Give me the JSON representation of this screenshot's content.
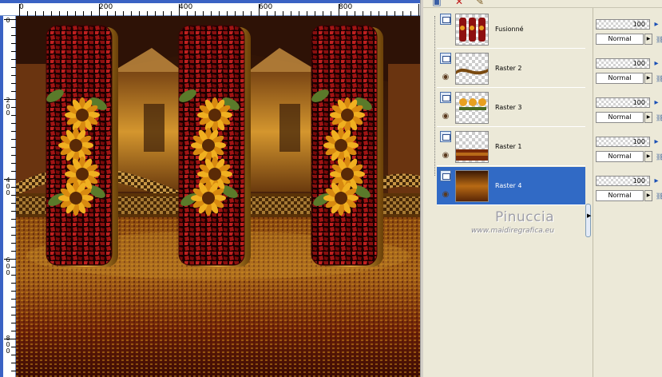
{
  "ruler": {
    "horizontal_labels": [
      "0",
      "200",
      "400",
      "600",
      "800"
    ],
    "vertical_labels": [
      "0",
      "200",
      "400",
      "600",
      "800"
    ]
  },
  "canvas": {
    "description": "",
    "colors": {
      "floor": "#8a2c0c",
      "panel_red": "#8e1010",
      "panel_gold": "#c58a10",
      "sky": "#3a1a06",
      "room": "#c8862a"
    }
  },
  "layers_panel": {
    "toolbar_icons": [
      "new-layer-icon",
      "delete-layer-icon",
      "edit-icon"
    ],
    "layers": [
      {
        "name": "Fusionné",
        "opacity": "100",
        "blend": "Normal",
        "selected": false,
        "visible": true,
        "thumb": "panels"
      },
      {
        "name": "Raster 2",
        "opacity": "100",
        "blend": "Normal",
        "selected": false,
        "visible": true,
        "thumb": "ribbon"
      },
      {
        "name": "Raster 3",
        "opacity": "100",
        "blend": "Normal",
        "selected": false,
        "visible": true,
        "thumb": "flowers"
      },
      {
        "name": "Raster 1",
        "opacity": "100",
        "blend": "Normal",
        "selected": false,
        "visible": true,
        "thumb": "floor"
      },
      {
        "name": "Raster 4",
        "opacity": "100",
        "blend": "Normal",
        "selected": true,
        "visible": true,
        "thumb": "gradient"
      }
    ],
    "watermark": {
      "name": "Pinuccia",
      "url": "www.maidiregrafica.eu"
    },
    "colors": {
      "selected": "#316ac5",
      "panel_bg": "#ece9d8"
    }
  }
}
